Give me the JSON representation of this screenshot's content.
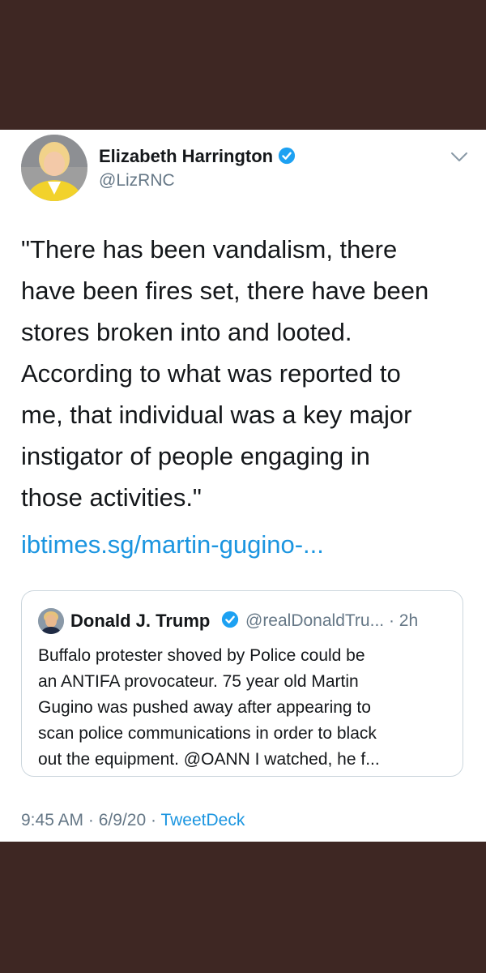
{
  "tweet": {
    "author_name": "Elizabeth Harrington",
    "author_handle": "@LizRNC",
    "text": "\"There has been vandalism, there\nhave been fires set, there have been\nstores broken into and looted.\nAccording to what was reported to\nme, that individual was a key major\ninstigator of people engaging in\nthose activities.\"",
    "link_text": "ibtimes.sg/martin-gugino-...",
    "time": "9:45 AM",
    "date": "6/9/20",
    "source": "TweetDeck",
    "sep": "·"
  },
  "quoted": {
    "author_name": "Donald J. Trump",
    "author_handle": "@realDonaldTru...",
    "age": "2h",
    "sep": "·",
    "text": "Buffalo protester shoved by Police could be\nan ANTIFA provocateur. 75 year old Martin\nGugino was pushed away after appearing to\nscan police communications in order to black\nout the equipment. @OANN  I watched, he f..."
  },
  "icons": {
    "verified": "verified-badge-icon",
    "chevron": "chevron-down-icon"
  },
  "colors": {
    "background_band": "#3e2723",
    "link": "#1b95e0",
    "secondary_text": "#657786",
    "verified": "#1da1f2"
  }
}
